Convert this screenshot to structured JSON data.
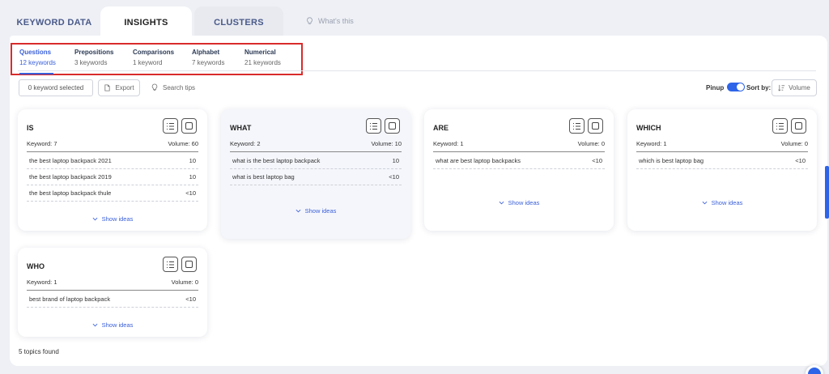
{
  "main_tabs": [
    {
      "label": "KEYWORD DATA"
    },
    {
      "label": "INSIGHTS"
    },
    {
      "label": "CLUSTERS"
    }
  ],
  "whats_this": "What's this",
  "sub_tabs": [
    {
      "title": "Questions",
      "count": "12 keywords"
    },
    {
      "title": "Prepositions",
      "count": "3 keywords"
    },
    {
      "title": "Comparisons",
      "count": "1 keyword"
    },
    {
      "title": "Alphabet",
      "count": "7 keywords"
    },
    {
      "title": "Numerical",
      "count": "21 keywords"
    }
  ],
  "toolbar": {
    "keyword_selected": "0 keyword selected",
    "export_label": "Export",
    "search_tips_label": "Search tips",
    "pinup_label": "Pinup",
    "pinup_on": true,
    "sort_by_label": "Sort by:",
    "sort_value": "Volume"
  },
  "cards": [
    {
      "title": "IS",
      "keyword": "Keyword: 7",
      "volume": "Volume: 60",
      "rows": [
        {
          "text": "the best laptop backpack 2021",
          "vol": "10"
        },
        {
          "text": "the best laptop backpack 2019",
          "vol": "10"
        },
        {
          "text": "the best laptop backpack thule",
          "vol": "<10"
        }
      ],
      "show": "Show ideas"
    },
    {
      "title": "WHAT",
      "keyword": "Keyword: 2",
      "volume": "Volume: 10",
      "rows": [
        {
          "text": "what is the best laptop backpack",
          "vol": "10"
        },
        {
          "text": "what is best laptop bag",
          "vol": "<10"
        }
      ],
      "show": "Show ideas"
    },
    {
      "title": "ARE",
      "keyword": "Keyword: 1",
      "volume": "Volume: 0",
      "rows": [
        {
          "text": "what are best laptop backpacks",
          "vol": "<10"
        }
      ],
      "show": "Show ideas"
    },
    {
      "title": "WHICH",
      "keyword": "Keyword: 1",
      "volume": "Volume: 0",
      "rows": [
        {
          "text": "which is best laptop bag",
          "vol": "<10"
        }
      ],
      "show": "Show ideas"
    },
    {
      "title": "WHO",
      "keyword": "Keyword: 1",
      "volume": "Volume: 0",
      "rows": [
        {
          "text": "best brand of laptop backpack",
          "vol": "<10"
        }
      ],
      "show": "Show ideas"
    }
  ],
  "topics_found": "5 topics found",
  "colors": {
    "accent": "#2e64e8",
    "highlight_border": "#d92b2b"
  }
}
